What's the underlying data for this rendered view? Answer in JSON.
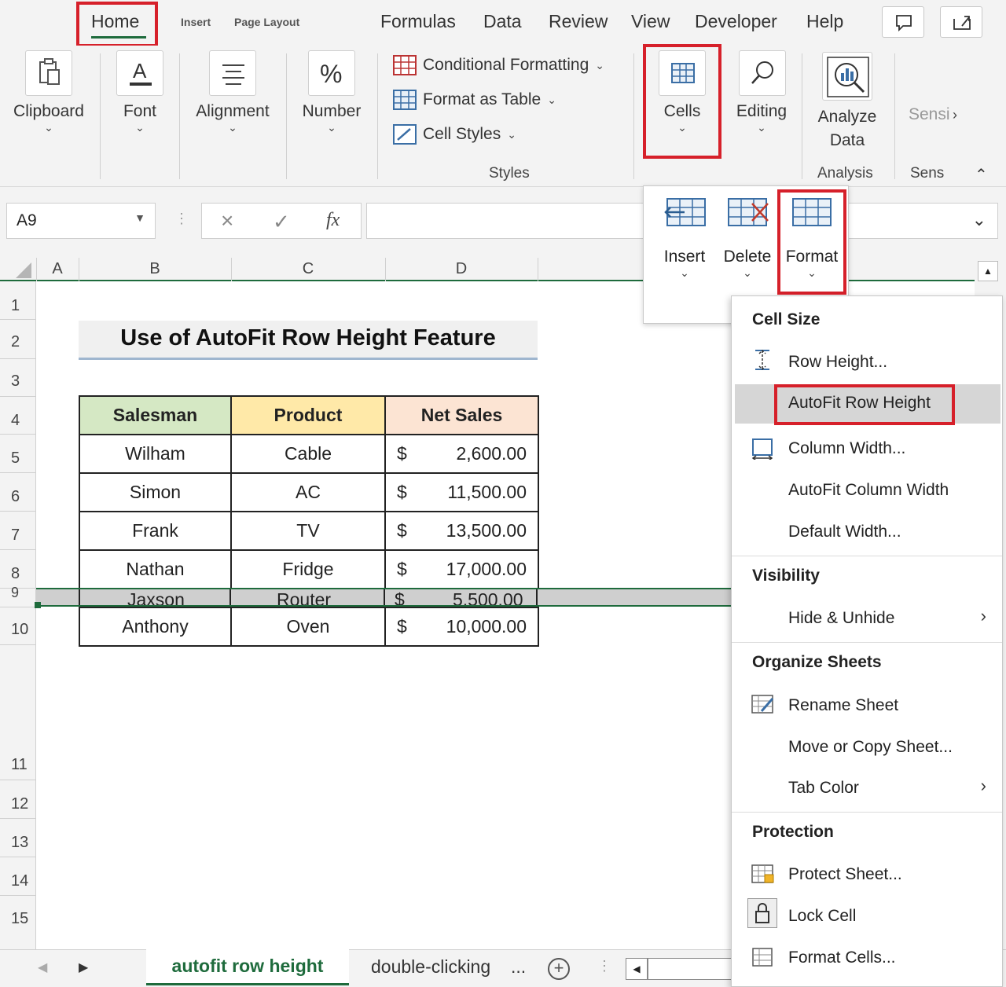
{
  "ribbon_tabs": {
    "home": "Home",
    "insert": "Insert",
    "page_layout": "Page Layout",
    "formulas": "Formulas",
    "data": "Data",
    "review": "Review",
    "view": "View",
    "developer": "Developer",
    "help": "Help"
  },
  "ribbon": {
    "clipboard": "Clipboard",
    "font": "Font",
    "alignment": "Alignment",
    "number": "Number",
    "conditional_formatting": "Conditional Formatting",
    "format_as_table": "Format as Table",
    "cell_styles": "Cell Styles",
    "styles_group": "Styles",
    "cells": "Cells",
    "editing": "Editing",
    "analyze_data_line1": "Analyze",
    "analyze_data_line2": "Data",
    "analysis_group": "Analysis",
    "sensitivity": "Sensi",
    "sens_group": "Sens"
  },
  "formula_bar": {
    "name_box": "A9",
    "fx": "fx",
    "formula": ""
  },
  "grid": {
    "columns": [
      "A",
      "B",
      "C",
      "D"
    ],
    "rows": [
      "1",
      "2",
      "3",
      "4",
      "5",
      "6",
      "7",
      "8",
      "9",
      "10",
      "11",
      "12",
      "13",
      "14",
      "15"
    ]
  },
  "sheet": {
    "title": "Use of AutoFit Row Height Feature",
    "headers": [
      "Salesman",
      "Product",
      "Net Sales"
    ],
    "rows": [
      {
        "salesman": "Wilham",
        "product": "Cable",
        "currency": "$",
        "amount": "2,600.00"
      },
      {
        "salesman": "Simon",
        "product": "AC",
        "currency": "$",
        "amount": "11,500.00"
      },
      {
        "salesman": "Frank",
        "product": "TV",
        "currency": "$",
        "amount": "13,500.00"
      },
      {
        "salesman": "Nathan",
        "product": "Fridge",
        "currency": "$",
        "amount": "17,000.00"
      },
      {
        "salesman": "Jaxson",
        "product": "Router",
        "currency": "$",
        "amount": "5,500.00"
      },
      {
        "salesman": "Anthony",
        "product": "Oven",
        "currency": "$",
        "amount": "10,000.00"
      }
    ]
  },
  "sheet_tabs": {
    "active": "autofit row height",
    "other": "double-clicking",
    "more": "..."
  },
  "cells_dropdown": {
    "insert": "Insert",
    "delete": "Delete",
    "format": "Format"
  },
  "format_menu": {
    "cell_size": "Cell Size",
    "row_height": "Row Height...",
    "autofit_row_height": "AutoFit Row Height",
    "column_width": "Column Width...",
    "autofit_column_width": "AutoFit Column Width",
    "default_width": "Default Width...",
    "visibility": "Visibility",
    "hide_unhide": "Hide & Unhide",
    "organize_sheets": "Organize Sheets",
    "rename_sheet": "Rename Sheet",
    "move_or_copy": "Move or Copy Sheet...",
    "tab_color": "Tab Color",
    "protection": "Protection",
    "protect_sheet": "Protect Sheet...",
    "lock_cell": "Lock Cell",
    "format_cells": "Format Cells..."
  },
  "colors": {
    "highlight_red": "#d6202a",
    "salesman_header": "#d5e8c4",
    "product_header": "#ffe9a8",
    "net_sales_header": "#fce4d3",
    "excel_green": "#1e6b3c"
  }
}
